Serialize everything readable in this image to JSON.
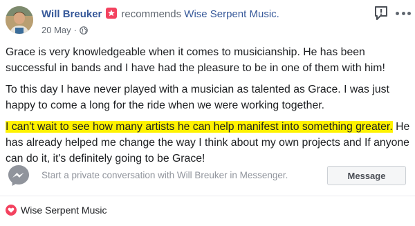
{
  "post": {
    "author": "Will Breuker",
    "action": "recommends",
    "page": "Wise Serpent Music.",
    "date": "20 May",
    "privacy_separator": "·",
    "paragraphs": [
      "Grace is very knowledgeable when it comes to musicianship. He has been successful in bands and I have had the pleasure to be in one of them with him!",
      "To this day I have never played with a musician as talented as Grace. I was just happy to come a long for the ride when we were working together."
    ],
    "highlighted_text": "I can't wait to see how many artists he can help manifest into something greater.",
    "after_highlight_text": " He has already helped me change the way I think about my own projects and If anyone can do it, it's definitely going to be Grace!"
  },
  "messenger": {
    "prompt": "Start a private conversation with Will Breuker in Messenger.",
    "button_label": "Message"
  },
  "footer": {
    "page_name": "Wise Serpent Music"
  },
  "colors": {
    "link": "#365899",
    "highlight": "#fff200",
    "badge": "#f3425f",
    "muted": "#606770"
  },
  "icons": [
    "recommend-star-icon",
    "globe-icon",
    "report-icon",
    "more-options-icon",
    "messenger-icon",
    "heart-icon"
  ]
}
